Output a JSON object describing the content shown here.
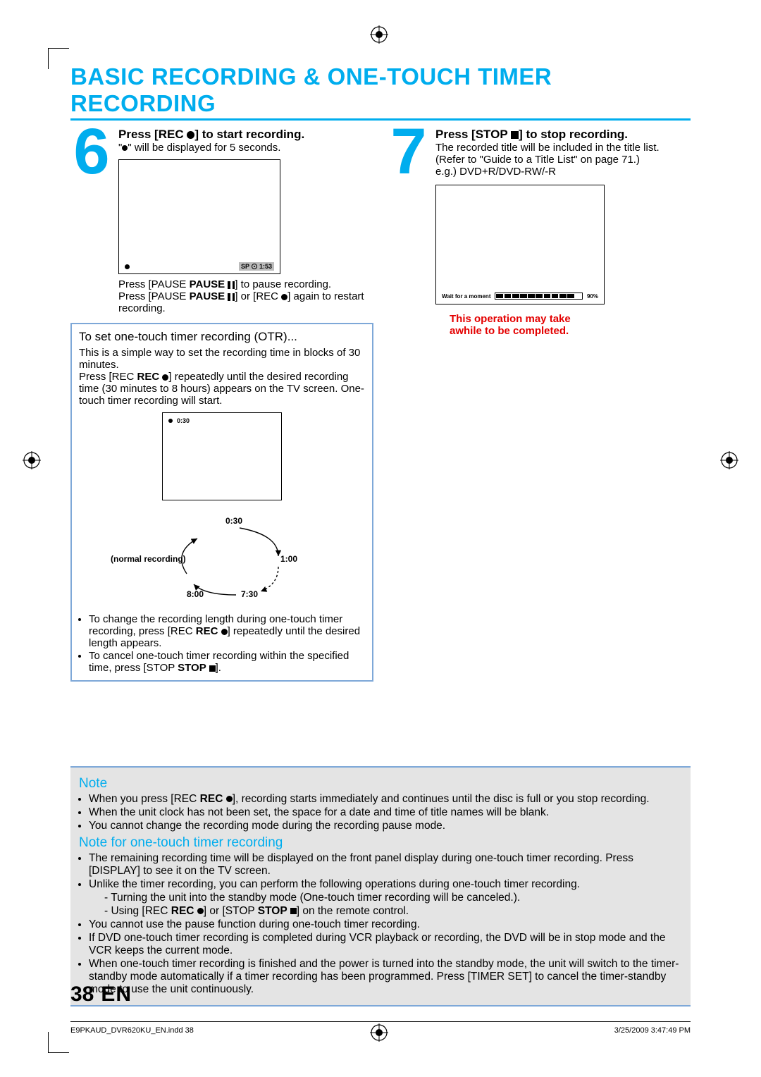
{
  "title": "BASIC RECORDING & ONE-TOUCH TIMER RECORDING",
  "step6": {
    "num": "6",
    "head_a": "Press [REC ",
    "head_b": "] to start recording.",
    "sub_a": "\"",
    "sub_b": "\" will be displayed for 5 seconds.",
    "tv_sp": "SP",
    "tv_time": "1:53",
    "pause_a": "Press [PAUSE ",
    "pause_b": "] to pause recording.",
    "restart_a": "Press [PAUSE ",
    "restart_b": "] or [REC ",
    "restart_c": "] again to restart recording."
  },
  "otr": {
    "title": "To set one-touch timer recording (OTR)...",
    "p1": "This is a simple way to set the recording time in blocks of 30 minutes.",
    "p2a": "Press [REC ",
    "p2b": "] repeatedly until the desired recording time (30 minutes to 8 hours) appears on the TV screen. One-touch timer recording will start.",
    "tv_time": "0:30",
    "cycle_normal": "(normal recording)",
    "cycle_0030": "0:30",
    "cycle_0100": "1:00",
    "cycle_0730": "7:30",
    "cycle_0800": "8:00",
    "bullet1a": "To change the recording length during one-touch timer recording, press [REC ",
    "bullet1b": "] repeatedly until the desired length appears.",
    "bullet2a": "To cancel one-touch timer recording within the specified time, press [STOP ",
    "bullet2b": "]."
  },
  "step7": {
    "num": "7",
    "head_a": "Press [STOP ",
    "head_b": "] to stop recording.",
    "p1": "The recorded title will be included in the title list. (Refer to \"Guide to a Title List\" on page 71.)",
    "p2": "e.g.) DVD+R/DVD-RW/-R",
    "wait": "Wait for a moment",
    "pct": "90%",
    "warn1": "This operation may take",
    "warn2": "awhile to be completed."
  },
  "notes": {
    "h1": "Note",
    "n1a": "When you press [REC ",
    "n1b": "], recording starts immediately and continues until the disc is full or you stop recording.",
    "n2": "When the unit clock has not been set, the space for a date and time of title names will be blank.",
    "n3": "You cannot change the recording mode during the recording pause mode.",
    "h2": "Note for one-touch timer recording",
    "m1": "The remaining recording time will be displayed on the front panel display during one-touch timer recording. Press [DISPLAY] to see it on the TV screen.",
    "m2": "Unlike the timer recording, you can perform the following operations during one-touch timer recording.",
    "m2a": "Turning the unit into the standby mode (One-touch timer recording will be canceled.).",
    "m2b_a": "Using [REC ",
    "m2b_b": "] or [STOP ",
    "m2b_c": "] on the remote control.",
    "m3": "You cannot use the pause function during one-touch timer recording.",
    "m4": "If DVD one-touch timer recording is completed during VCR playback or recording, the DVD will be in stop mode and the VCR keeps the current mode.",
    "m5": "When one-touch timer recording is finished and the power is turned into the standby mode, the unit will switch to the timer-standby mode automatically if a timer recording has been programmed. Press [TIMER SET] to cancel the timer-standby mode to use the unit continuously."
  },
  "footer": {
    "page": "38",
    "lang": "EN",
    "file": "E9PKAUD_DVR620KU_EN.indd   38",
    "ts": "3/25/2009   3:47:49 PM"
  }
}
